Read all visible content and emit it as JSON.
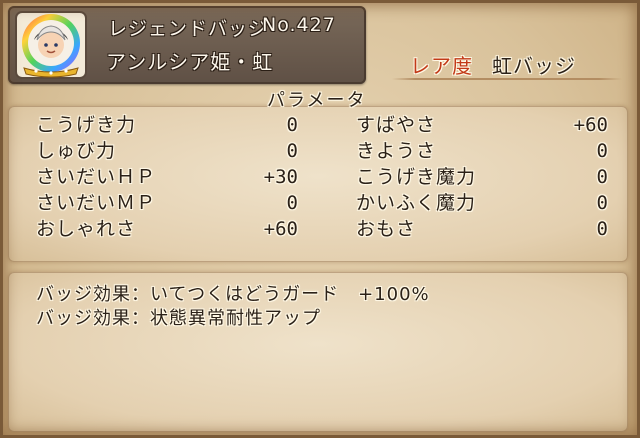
{
  "header": {
    "badge_type": "レジェンドバッジ",
    "badge_no_label": "No.427",
    "badge_name": "アンルシア姫・虹"
  },
  "rarity": {
    "label": "レア度",
    "value": "虹バッジ"
  },
  "params": {
    "title": "パラメータ",
    "left": [
      {
        "name": "こうげき力",
        "value": "0"
      },
      {
        "name": "しゅび力",
        "value": "0"
      },
      {
        "name": "さいだいＨＰ",
        "value": "+30"
      },
      {
        "name": "さいだいＭＰ",
        "value": "0"
      },
      {
        "name": "おしゃれさ",
        "value": "+60"
      }
    ],
    "right": [
      {
        "name": "すばやさ",
        "value": "+60"
      },
      {
        "name": "きようさ",
        "value": "0"
      },
      {
        "name": "こうげき魔力",
        "value": "0"
      },
      {
        "name": "かいふく魔力",
        "value": "0"
      },
      {
        "name": "おもさ",
        "value": "0"
      }
    ]
  },
  "effects": [
    "バッジ効果：いてつくはどうガード　+100%",
    "バッジ効果：状態異常耐性アップ"
  ],
  "icons": {
    "badge": "princess-portrait-badge-icon"
  },
  "colors": {
    "rarity_label": "#c23a18",
    "header_plate": "#6c5c50"
  }
}
